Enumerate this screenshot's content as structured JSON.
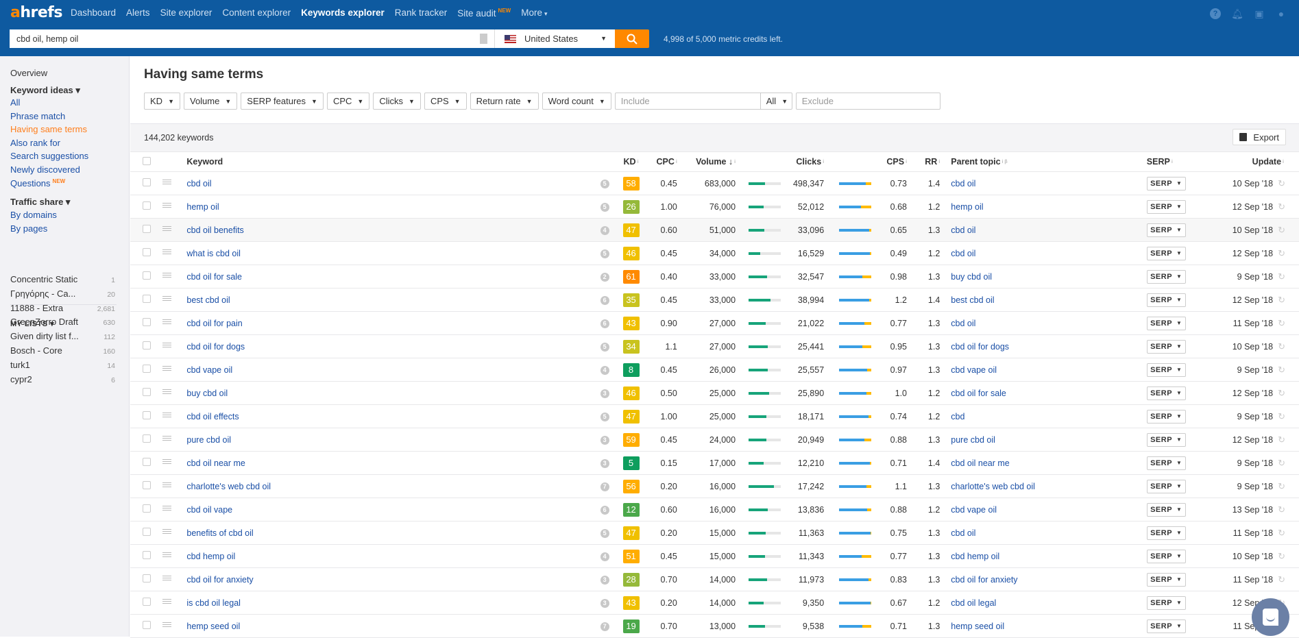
{
  "app": {
    "logo_a": "a",
    "logo_rest": "hrefs"
  },
  "nav": [
    {
      "label": "Dashboard",
      "active": false
    },
    {
      "label": "Alerts",
      "active": false
    },
    {
      "label": "Site explorer",
      "active": false
    },
    {
      "label": "Content explorer",
      "active": false
    },
    {
      "label": "Keywords explorer",
      "active": true
    },
    {
      "label": "Rank tracker",
      "active": false
    },
    {
      "label": "Site audit",
      "badge": "NEW",
      "active": false
    },
    {
      "label": "More",
      "caret": "▾",
      "active": false
    }
  ],
  "top_icons": [
    "help-icon",
    "bell-icon",
    "messages-icon",
    "user-icon"
  ],
  "search": {
    "value": "cbd oil, hemp oil",
    "country": "United States",
    "credits": "4,998 of 5,000 metric credits left."
  },
  "sidebar": {
    "overview": "Overview",
    "keyword_ideas": "Keyword ideas ▾",
    "items": [
      {
        "label": "All"
      },
      {
        "label": "Phrase match"
      },
      {
        "label": "Having same terms",
        "active": true
      },
      {
        "label": "Also rank for"
      },
      {
        "label": "Search suggestions"
      },
      {
        "label": "Newly discovered"
      },
      {
        "label": "Questions",
        "badge": "NEW"
      }
    ],
    "traffic_share": "Traffic share ▾",
    "traffic_items": [
      {
        "label": "By domains"
      },
      {
        "label": "By pages"
      }
    ],
    "my_lists_label": "MY LISTS ▾",
    "lists": [
      {
        "name": "Concentric Static",
        "count": "1"
      },
      {
        "name": "Γρηγόρης - Ca...",
        "count": "20"
      },
      {
        "name": "11888 - Extra",
        "count": "2,681"
      },
      {
        "name": "GreenZorro Draft",
        "count": "630"
      },
      {
        "name": "Given dirty list f...",
        "count": "112"
      },
      {
        "name": "Bosch - Core",
        "count": "160"
      },
      {
        "name": "turk1",
        "count": "14"
      },
      {
        "name": "cypr2",
        "count": "6"
      }
    ]
  },
  "main": {
    "title": "Having same terms",
    "filters": [
      "KD",
      "Volume",
      "SERP features",
      "CPC",
      "Clicks",
      "CPS",
      "Return rate",
      "Word count"
    ],
    "include_placeholder": "Include",
    "include_mode": "All",
    "exclude_placeholder": "Exclude",
    "keyword_count": "144,202 keywords",
    "export_label": "Export"
  },
  "table": {
    "headers": {
      "keyword": "Keyword",
      "kd": "KD",
      "cpc": "CPC",
      "volume": "Volume ↓",
      "clicks": "Clicks",
      "cps": "CPS",
      "rr": "RR",
      "parent": "Parent topic",
      "serp": "SERP",
      "update": "Update"
    },
    "serp_button": "SERP",
    "kd_colors": {
      "very_easy": "#0e9e5e",
      "easy": "#4ba84a",
      "medium_low": "#95b93a",
      "medium": "#c9c31f",
      "medium_high": "#f0c000",
      "hard": "#ffad00",
      "very_hard": "#ff8a00"
    },
    "rows": [
      {
        "keyword": "cbd oil",
        "sf": "5",
        "kd": 58,
        "kd_color": "#ffad00",
        "cpc": "0.45",
        "volume": "683,000",
        "vol_fill": 0.52,
        "clicks": "498,347",
        "paid_share": 0.17,
        "cps": "0.73",
        "rr": "1.4",
        "parent": "cbd oil",
        "update": "10 Sep '18"
      },
      {
        "keyword": "hemp oil",
        "sf": "5",
        "kd": 26,
        "kd_color": "#95b93a",
        "cpc": "1.00",
        "volume": "76,000",
        "vol_fill": 0.47,
        "clicks": "52,012",
        "paid_share": 0.3,
        "cps": "0.68",
        "rr": "1.2",
        "parent": "hemp oil",
        "update": "12 Sep '18"
      },
      {
        "keyword": "cbd oil benefits",
        "sf": "4",
        "kd": 47,
        "kd_color": "#f0c000",
        "cpc": "0.60",
        "volume": "51,000",
        "vol_fill": 0.49,
        "clicks": "33,096",
        "paid_share": 0.06,
        "cps": "0.65",
        "rr": "1.3",
        "parent": "cbd oil",
        "update": "10 Sep '18",
        "highlight": true
      },
      {
        "keyword": "what is cbd oil",
        "sf": "5",
        "kd": 46,
        "kd_color": "#f0c000",
        "cpc": "0.45",
        "volume": "34,000",
        "vol_fill": 0.38,
        "clicks": "16,529",
        "paid_share": 0.04,
        "cps": "0.49",
        "rr": "1.2",
        "parent": "cbd oil",
        "update": "12 Sep '18"
      },
      {
        "keyword": "cbd oil for sale",
        "sf": "2",
        "kd": 61,
        "kd_color": "#ff8a00",
        "cpc": "0.40",
        "volume": "33,000",
        "vol_fill": 0.58,
        "clicks": "32,547",
        "paid_share": 0.26,
        "cps": "0.98",
        "rr": "1.3",
        "parent": "buy cbd oil",
        "update": "9 Sep '18"
      },
      {
        "keyword": "best cbd oil",
        "sf": "6",
        "kd": 35,
        "kd_color": "#c9c31f",
        "cpc": "0.45",
        "volume": "33,000",
        "vol_fill": 0.69,
        "clicks": "38,994",
        "paid_share": 0.06,
        "cps": "1.2",
        "rr": "1.4",
        "parent": "best cbd oil",
        "update": "12 Sep '18"
      },
      {
        "keyword": "cbd oil for pain",
        "sf": "6",
        "kd": 43,
        "kd_color": "#f0c000",
        "cpc": "0.90",
        "volume": "27,000",
        "vol_fill": 0.54,
        "clicks": "21,022",
        "paid_share": 0.21,
        "cps": "0.77",
        "rr": "1.3",
        "parent": "cbd oil",
        "update": "11 Sep '18"
      },
      {
        "keyword": "cbd oil for dogs",
        "sf": "5",
        "kd": 34,
        "kd_color": "#c9c31f",
        "cpc": "1.1",
        "volume": "27,000",
        "vol_fill": 0.6,
        "clicks": "25,441",
        "paid_share": 0.26,
        "cps": "0.95",
        "rr": "1.3",
        "parent": "cbd oil for dogs",
        "update": "10 Sep '18"
      },
      {
        "keyword": "cbd vape oil",
        "sf": "4",
        "kd": 8,
        "kd_color": "#0e9e5e",
        "cpc": "0.45",
        "volume": "26,000",
        "vol_fill": 0.6,
        "clicks": "25,557",
        "paid_share": 0.11,
        "cps": "0.97",
        "rr": "1.3",
        "parent": "cbd vape oil",
        "update": "9 Sep '18"
      },
      {
        "keyword": "buy cbd oil",
        "sf": "3",
        "kd": 46,
        "kd_color": "#f0c000",
        "cpc": "0.50",
        "volume": "25,000",
        "vol_fill": 0.64,
        "clicks": "25,890",
        "paid_share": 0.15,
        "cps": "1.0",
        "rr": "1.2",
        "parent": "cbd oil for sale",
        "update": "12 Sep '18"
      },
      {
        "keyword": "cbd oil effects",
        "sf": "5",
        "kd": 47,
        "kd_color": "#f0c000",
        "cpc": "1.00",
        "volume": "25,000",
        "vol_fill": 0.56,
        "clicks": "18,171",
        "paid_share": 0.07,
        "cps": "0.74",
        "rr": "1.2",
        "parent": "cbd",
        "update": "9 Sep '18"
      },
      {
        "keyword": "pure cbd oil",
        "sf": "3",
        "kd": 59,
        "kd_color": "#ffad00",
        "cpc": "0.45",
        "volume": "24,000",
        "vol_fill": 0.56,
        "clicks": "20,949",
        "paid_share": 0.2,
        "cps": "0.88",
        "rr": "1.3",
        "parent": "pure cbd oil",
        "update": "12 Sep '18"
      },
      {
        "keyword": "cbd oil near me",
        "sf": "3",
        "kd": 5,
        "kd_color": "#0e9e5e",
        "cpc": "0.15",
        "volume": "17,000",
        "vol_fill": 0.47,
        "clicks": "12,210",
        "paid_share": 0.04,
        "cps": "0.71",
        "rr": "1.4",
        "parent": "cbd oil near me",
        "update": "9 Sep '18"
      },
      {
        "keyword": "charlotte's web cbd oil",
        "sf": "7",
        "kd": 56,
        "kd_color": "#ffad00",
        "cpc": "0.20",
        "volume": "16,000",
        "vol_fill": 0.79,
        "clicks": "17,242",
        "paid_share": 0.15,
        "cps": "1.1",
        "rr": "1.3",
        "parent": "charlotte's web cbd oil",
        "update": "9 Sep '18"
      },
      {
        "keyword": "cbd oil vape",
        "sf": "6",
        "kd": 12,
        "kd_color": "#4ba84a",
        "cpc": "0.60",
        "volume": "16,000",
        "vol_fill": 0.6,
        "clicks": "13,836",
        "paid_share": 0.11,
        "cps": "0.88",
        "rr": "1.2",
        "parent": "cbd vape oil",
        "update": "13 Sep '18"
      },
      {
        "keyword": "benefits of cbd oil",
        "sf": "5",
        "kd": 47,
        "kd_color": "#f0c000",
        "cpc": "0.20",
        "volume": "15,000",
        "vol_fill": 0.54,
        "clicks": "11,363",
        "paid_share": 0.02,
        "cps": "0.75",
        "rr": "1.3",
        "parent": "cbd oil",
        "update": "11 Sep '18"
      },
      {
        "keyword": "cbd hemp oil",
        "sf": "4",
        "kd": 51,
        "kd_color": "#ffad00",
        "cpc": "0.45",
        "volume": "15,000",
        "vol_fill": 0.51,
        "clicks": "11,343",
        "paid_share": 0.28,
        "cps": "0.77",
        "rr": "1.3",
        "parent": "cbd hemp oil",
        "update": "10 Sep '18"
      },
      {
        "keyword": "cbd oil for anxiety",
        "sf": "3",
        "kd": 28,
        "kd_color": "#95b93a",
        "cpc": "0.70",
        "volume": "14,000",
        "vol_fill": 0.58,
        "clicks": "11,973",
        "paid_share": 0.08,
        "cps": "0.83",
        "rr": "1.3",
        "parent": "cbd oil for anxiety",
        "update": "11 Sep '18"
      },
      {
        "keyword": "is cbd oil legal",
        "sf": "3",
        "kd": 43,
        "kd_color": "#f0c000",
        "cpc": "0.20",
        "volume": "14,000",
        "vol_fill": 0.47,
        "clicks": "9,350",
        "paid_share": 0.02,
        "cps": "0.67",
        "rr": "1.2",
        "parent": "cbd oil legal",
        "update": "12 Sep '18"
      },
      {
        "keyword": "hemp seed oil",
        "sf": "7",
        "kd": 19,
        "kd_color": "#4ba84a",
        "cpc": "0.70",
        "volume": "13,000",
        "vol_fill": 0.51,
        "clicks": "9,538",
        "paid_share": 0.27,
        "cps": "0.71",
        "rr": "1.3",
        "parent": "hemp seed oil",
        "update": "11 Sep '18"
      }
    ]
  }
}
